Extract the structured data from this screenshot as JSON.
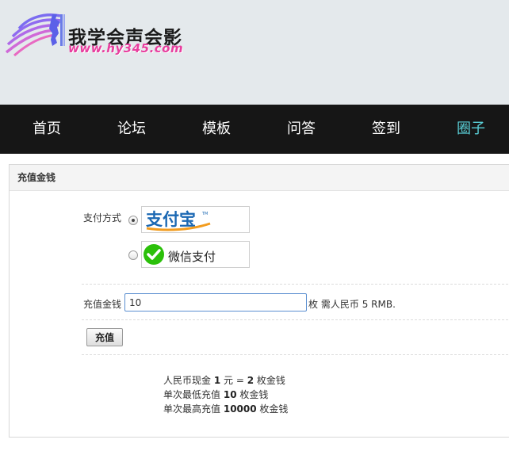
{
  "header": {
    "logo_title": "我学会声会影",
    "logo_url": "www.hy345.com"
  },
  "nav": {
    "items": [
      {
        "label": "首页"
      },
      {
        "label": "论坛"
      },
      {
        "label": "模板"
      },
      {
        "label": "问答"
      },
      {
        "label": "签到"
      },
      {
        "label": "圈子",
        "active": true
      }
    ]
  },
  "panel": {
    "title": "充值金钱",
    "payment": {
      "label": "支付方式",
      "options": [
        {
          "name": "支付宝",
          "selected": true
        },
        {
          "name": "微信支付",
          "selected": false
        }
      ]
    },
    "amount": {
      "label": "充值金钱",
      "value": "10",
      "unit": "枚",
      "cost_prefix": "需人民币",
      "cost_value": "5",
      "cost_suffix": "RMB."
    },
    "submit_label": "充值",
    "info": {
      "line1": {
        "a": "人民币现金",
        "b": "1",
        "c": "元 =",
        "d": "2",
        "e": "枚金钱"
      },
      "line2": {
        "a": "单次最低充值",
        "b": "10",
        "c": "枚金钱"
      },
      "line3": {
        "a": "单次最高充值",
        "b": "10000",
        "c": "枚金钱"
      }
    }
  },
  "colors": {
    "header_bg": "#e4e9ec",
    "nav_bg": "#161616",
    "nav_active": "#5ad0d8",
    "input_border": "#5b8fd0",
    "logo_url": "#e83f9f",
    "alipay_blue": "#1b68b3",
    "alipay_orange": "#f29c1f",
    "wechat_green": "#2bc00a"
  },
  "icons": {
    "logo": "woman-profile-logo-icon",
    "alipay": "alipay-logo-icon",
    "wechat": "wechat-check-icon"
  }
}
